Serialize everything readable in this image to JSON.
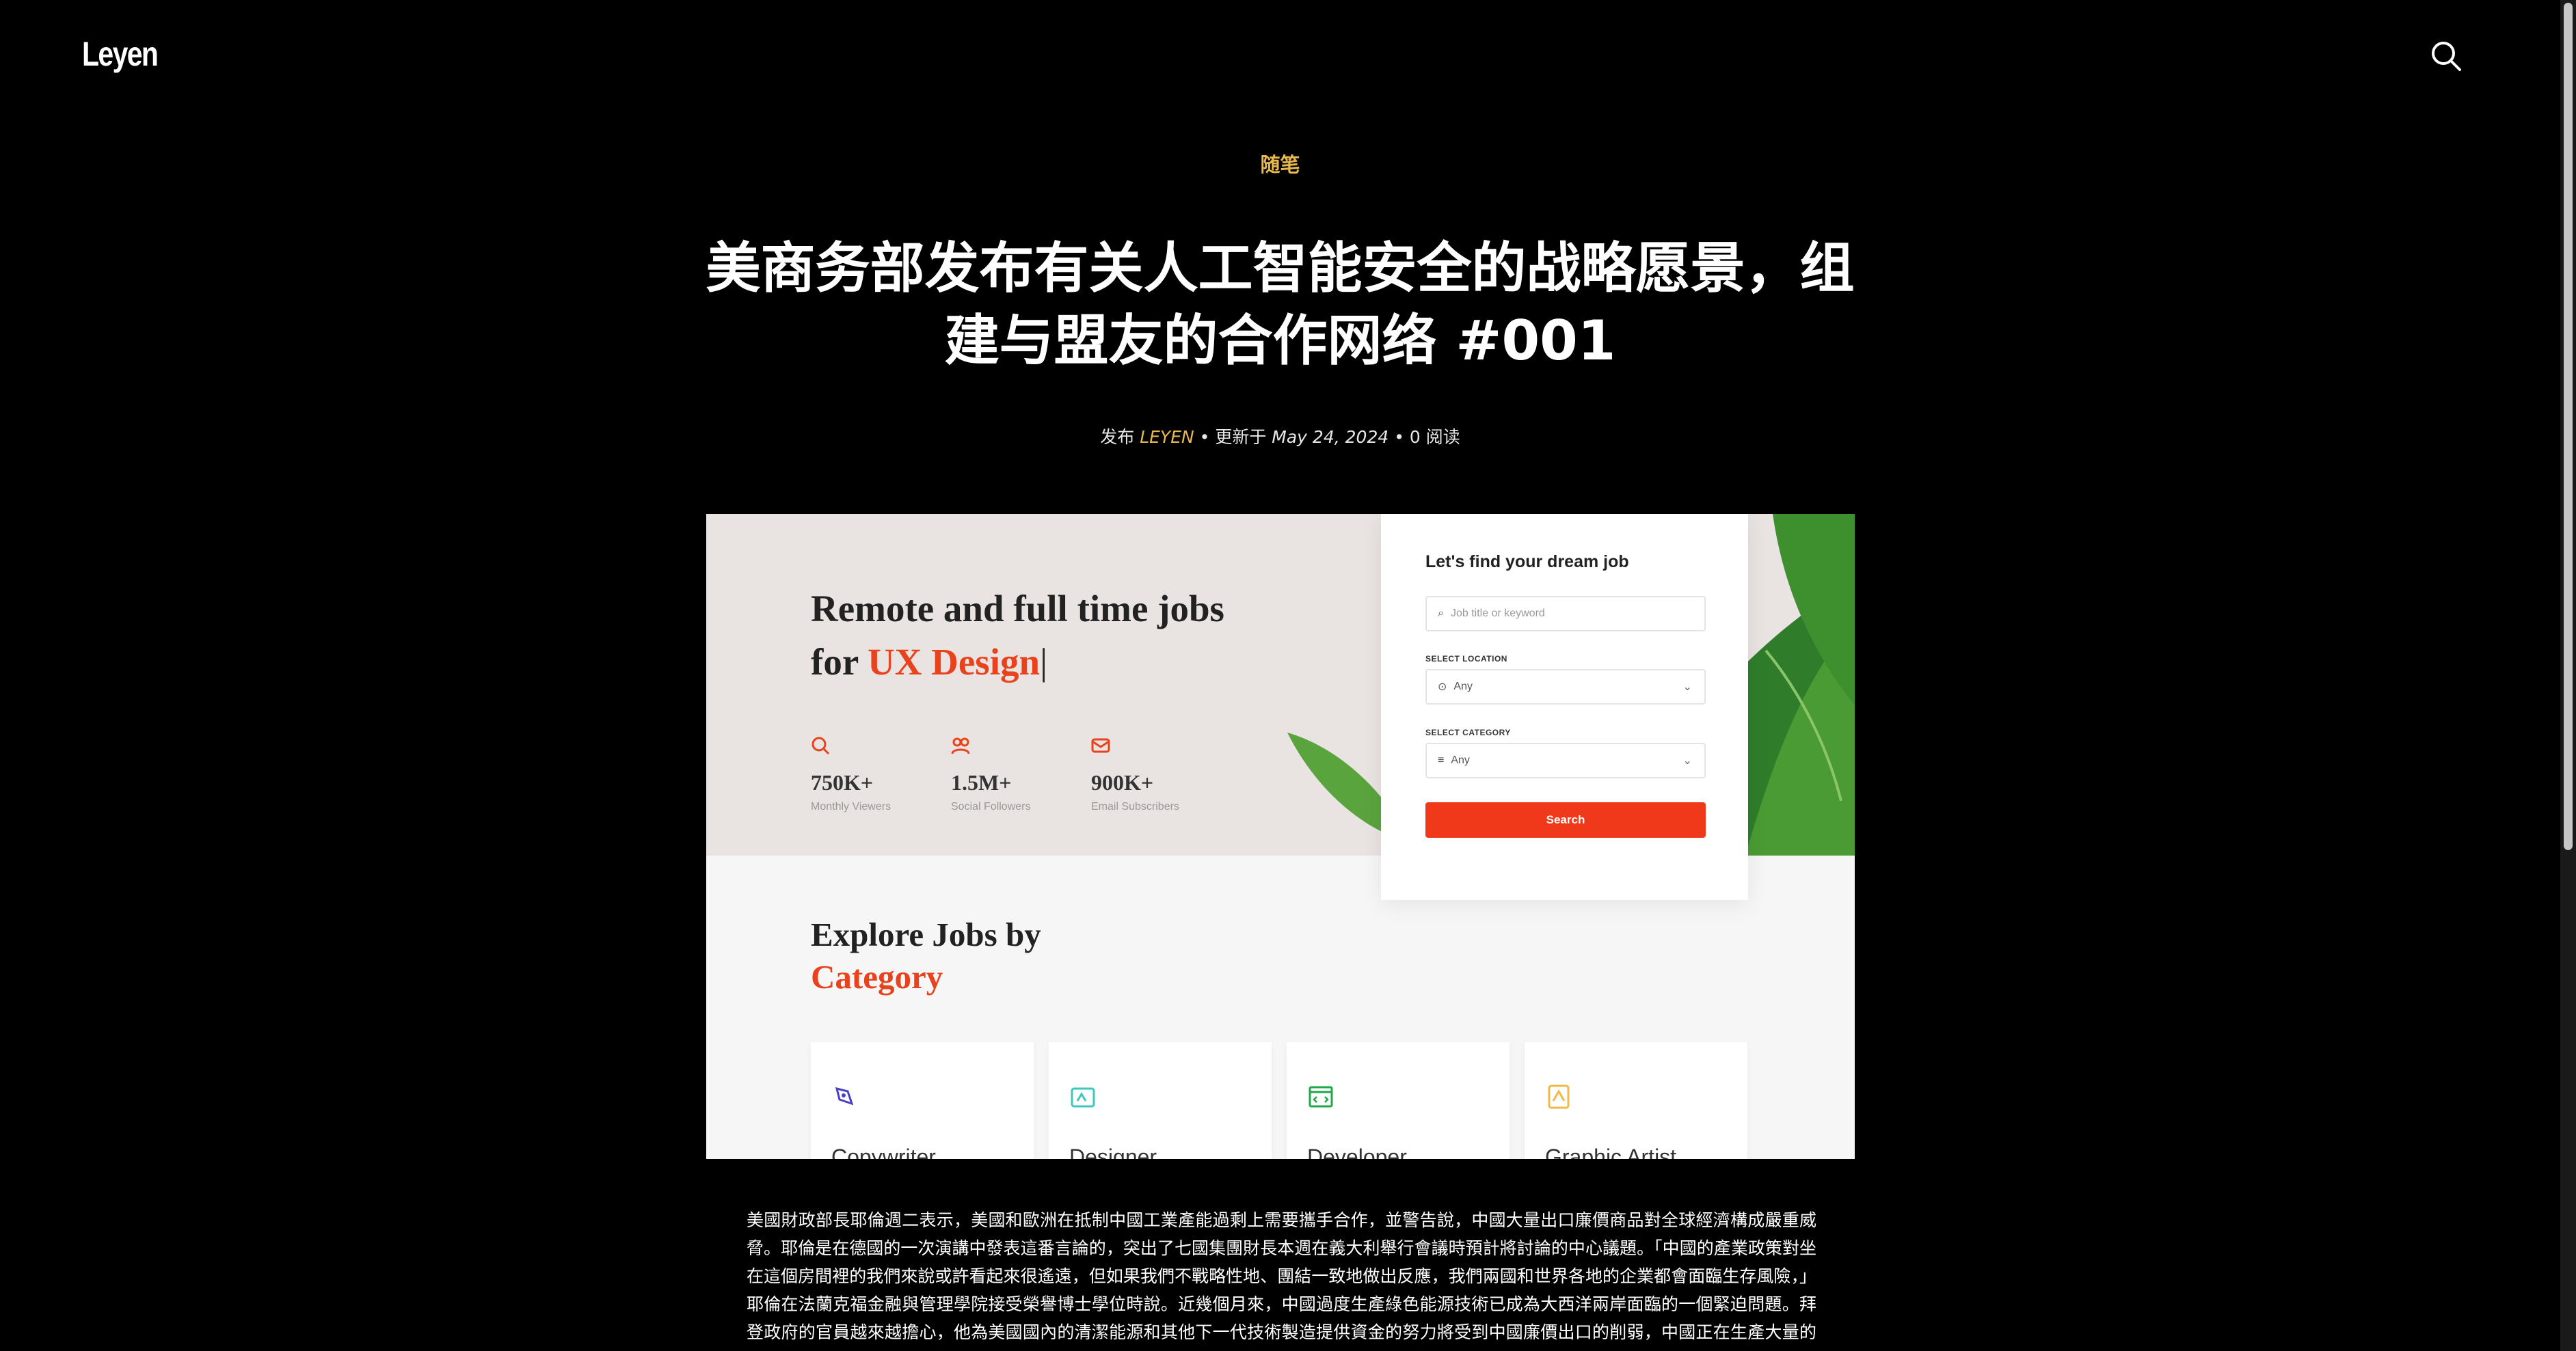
{
  "site": {
    "logo": "Leyen"
  },
  "article": {
    "category": "随笔",
    "title": "美商务部发布有关人工智能安全的战略愿景，组建与盟友的合作网络 #001",
    "meta": {
      "prefix": "发布",
      "author": "LEYEN",
      "sep1": " • 更新于 ",
      "date": "May 24, 2024",
      "sep2": " • 0 阅读"
    },
    "body": "美國財政部長耶倫週二表示，美國和歐洲在抵制中國工業產能過剩上需要攜手合作，並警告說，中國大量出口廉價商品對全球經濟構成嚴重威脅。耶倫是在德國的一次演講中發表這番言論的，突出了七國集團財長本週在義大利舉行會議時預計將討論的中心議題。「中國的產業政策對坐在這個房間裡的我們來說或許看起來很遙遠，但如果我們不戰略性地、團結一致地做出反應，我們兩國和世界各地的企業都會面臨生存風險，」耶倫在法蘭克福金融與管理學院接受榮譽博士學位時說。近幾個月來，中國過度生產綠色能源技術已成為大西洋兩岸面臨的一個緊迫問題。拜登政府的官員越來越擔心，他為美國國內的清潔能源和其他下一代技術製造提供資金的努力將受到中國廉價出口的削弱，中國正在生產大量的鋼"
  },
  "hero_image": {
    "headline_line1": "Remote and full time jobs",
    "headline_line2_prefix": "for ",
    "headline_line2_accent": "UX Design",
    "stats": [
      {
        "value": "750K+",
        "label": "Monthly Viewers"
      },
      {
        "value": "1.5M+",
        "label": "Social Followers"
      },
      {
        "value": "900K+",
        "label": "Email Subscribers"
      }
    ],
    "card": {
      "title": "Let's find your dream job",
      "keyword_placeholder": "Job title or keyword",
      "location_label": "SELECT LOCATION",
      "location_value": "Any",
      "category_label": "SELECT CATEGORY",
      "category_value": "Any",
      "search_label": "Search"
    },
    "explore_line1": "Explore Jobs by",
    "explore_line2": "Category",
    "categories": [
      "Copywriter",
      "Designer",
      "Developer",
      "Graphic Artist"
    ]
  },
  "colors": {
    "accent": "#e7b84d",
    "brand_orange": "#e8431d",
    "button_red": "#f0381b"
  },
  "icons": {
    "header_search": "search-icon"
  }
}
